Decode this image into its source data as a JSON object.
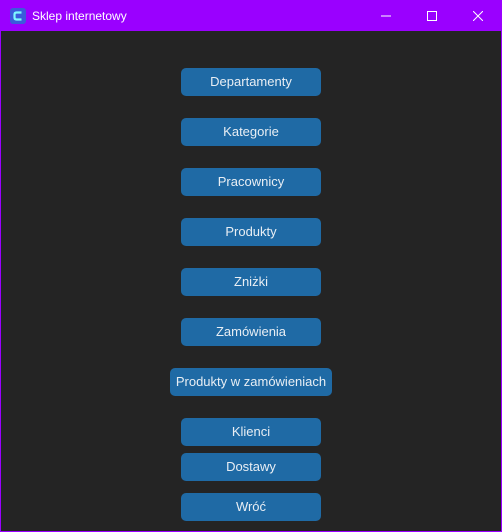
{
  "window": {
    "title": "Sklep internetowy",
    "app_icon": "customtkinter-app-icon",
    "controls": [
      "minimize-icon",
      "maximize-icon",
      "close-icon"
    ]
  },
  "colors": {
    "titlebar": "#9a00ff",
    "background": "#242424",
    "button": "#1f6aa5",
    "button_text": "#e8eef4"
  },
  "menu": {
    "departamenty": "Departamenty",
    "kategorie": "Kategorie",
    "pracownicy": "Pracownicy",
    "produkty": "Produkty",
    "znizki": "Zniżki",
    "zamowienia": "Zamówienia",
    "produkty_w_zamowieniach": "Produkty w zamówieniach",
    "klienci": "Klienci",
    "dostawy": "Dostawy",
    "wroc": "Wróć"
  }
}
